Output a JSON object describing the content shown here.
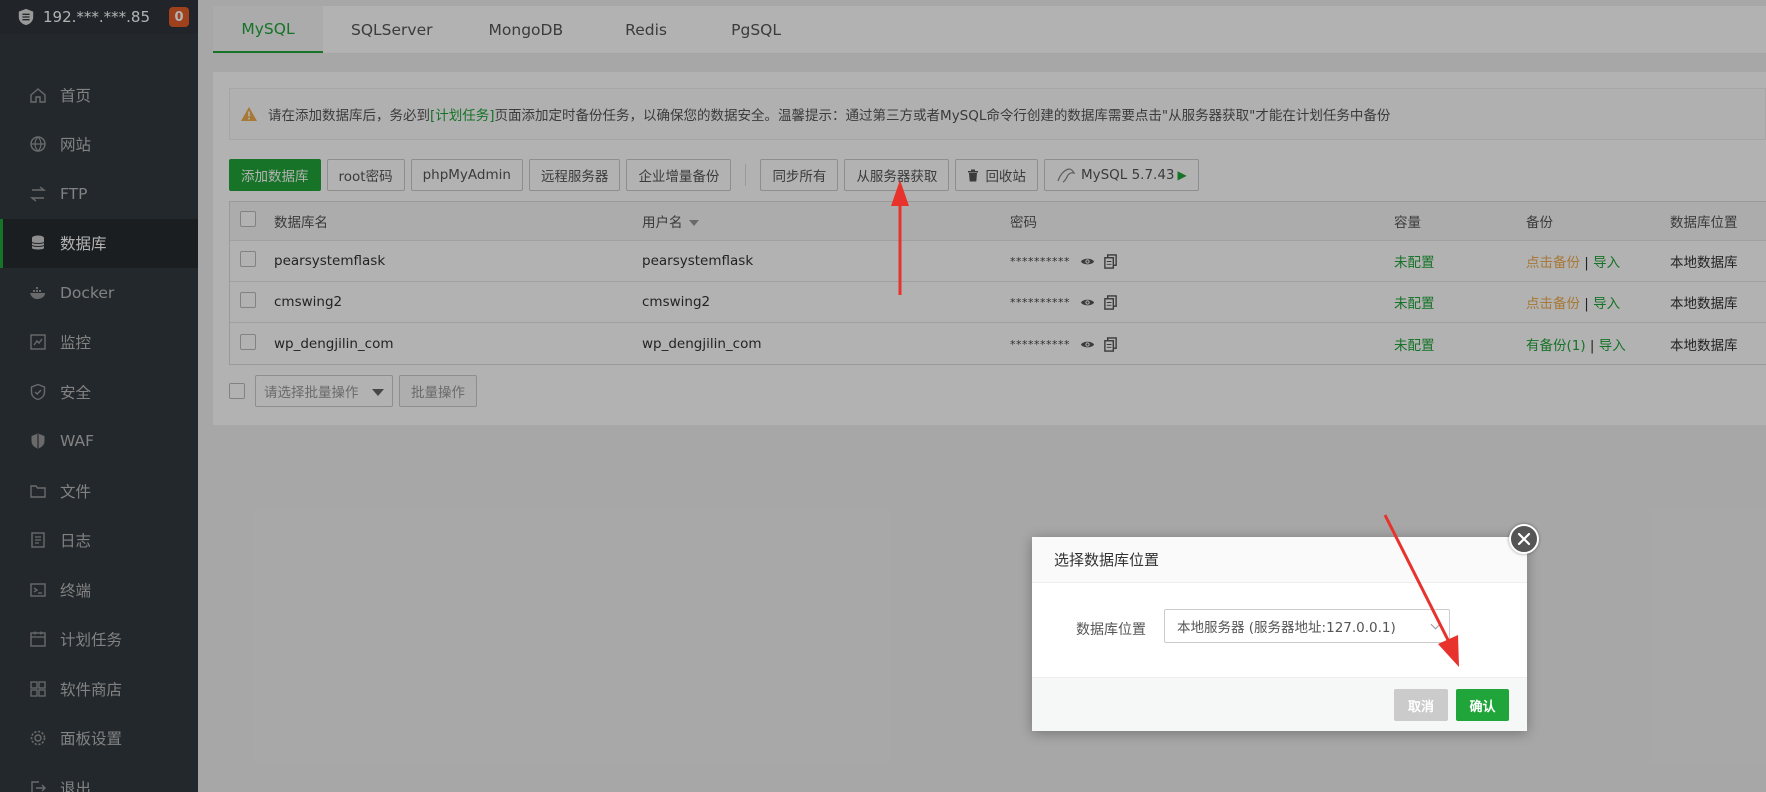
{
  "sidebar": {
    "host": "192.***.***.85",
    "badge": "0",
    "items": [
      {
        "label": "首页",
        "icon": "home-icon"
      },
      {
        "label": "网站",
        "icon": "globe-icon"
      },
      {
        "label": "FTP",
        "icon": "ftp-icon"
      },
      {
        "label": "数据库",
        "icon": "database-icon",
        "active": true
      },
      {
        "label": "Docker",
        "icon": "docker-icon"
      },
      {
        "label": "监控",
        "icon": "monitor-icon"
      },
      {
        "label": "安全",
        "icon": "shield-icon"
      },
      {
        "label": "WAF",
        "icon": "waf-icon"
      },
      {
        "label": "文件",
        "icon": "folder-icon"
      },
      {
        "label": "日志",
        "icon": "log-icon"
      },
      {
        "label": "终端",
        "icon": "terminal-icon"
      },
      {
        "label": "计划任务",
        "icon": "calendar-icon"
      },
      {
        "label": "软件商店",
        "icon": "apps-icon"
      },
      {
        "label": "面板设置",
        "icon": "gear-icon"
      },
      {
        "label": "退出",
        "icon": "logout-icon"
      }
    ]
  },
  "tabs": [
    "MySQL",
    "SQLServer",
    "MongoDB",
    "Redis",
    "PgSQL"
  ],
  "notice": {
    "before": "请在添加数据库后，务必到",
    "link": "[计划任务]",
    "after": "页面添加定时备份任务，以确保您的数据安全。温馨提示：通过第三方或者MySQL命令行创建的数据库需要点击\"从服务器获取\"才能在计划任务中备份"
  },
  "toolbar": {
    "add_db": "添加数据库",
    "root_pwd": "root密码",
    "phpmyadmin": "phpMyAdmin",
    "remote": "远程服务器",
    "incremental": "企业增量备份",
    "sync_all": "同步所有",
    "from_server": "从服务器获取",
    "recycle": "回收站",
    "mysql_version": "MySQL 5.7.43"
  },
  "table": {
    "headers": {
      "name": "数据库名",
      "user": "用户名",
      "password": "密码",
      "capacity": "容量",
      "backup": "备份",
      "location": "数据库位置"
    },
    "rows": [
      {
        "name": "pearsystemflask",
        "user": "pearsystemflask",
        "password": "**********",
        "capacity": "未配置",
        "backup": "点击备份",
        "import": "导入",
        "location": "本地数据库"
      },
      {
        "name": "cmswing2",
        "user": "cmswing2",
        "password": "**********",
        "capacity": "未配置",
        "backup": "点击备份",
        "import": "导入",
        "location": "本地数据库"
      },
      {
        "name": "wp_dengjilin_com",
        "user": "wp_dengjilin_com",
        "password": "**********",
        "capacity": "未配置",
        "backup": "有备份(1)",
        "import": "导入",
        "location": "本地数据库"
      }
    ],
    "sep": "|"
  },
  "batch": {
    "placeholder": "请选择批量操作",
    "button": "批量操作"
  },
  "dialog": {
    "title": "选择数据库位置",
    "label": "数据库位置",
    "value": "本地服务器 (服务器地址:127.0.0.1)",
    "cancel": "取消",
    "confirm": "确认"
  },
  "colors": {
    "accent": "#20a53a",
    "arrow": "#e8322c",
    "badge": "#e65d2b"
  }
}
